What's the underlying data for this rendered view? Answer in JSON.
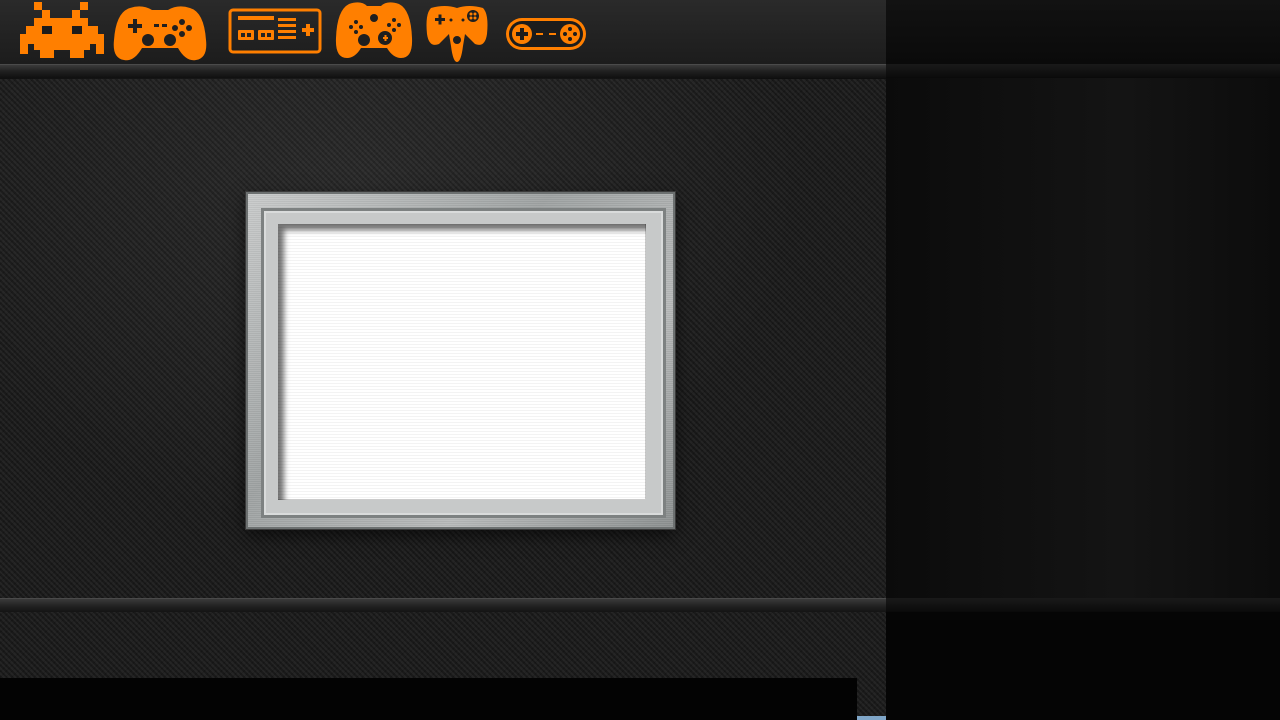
{
  "accent_color": "#ff7f00",
  "system_bar": {
    "items": [
      {
        "name": "arcade",
        "icon": "space-invader-icon"
      },
      {
        "name": "playstation",
        "icon": "playstation-controller-icon"
      },
      {
        "name": "nes",
        "icon": "nes-controller-icon"
      },
      {
        "name": "xbox",
        "icon": "xbox-controller-icon"
      },
      {
        "name": "nintendo-64",
        "icon": "n64-controller-icon"
      },
      {
        "name": "snes",
        "icon": "snes-controller-icon"
      }
    ]
  },
  "preview": {
    "frame_style": "brushed-metal",
    "screen_state": "blank"
  },
  "info_bar": {
    "text": ""
  }
}
